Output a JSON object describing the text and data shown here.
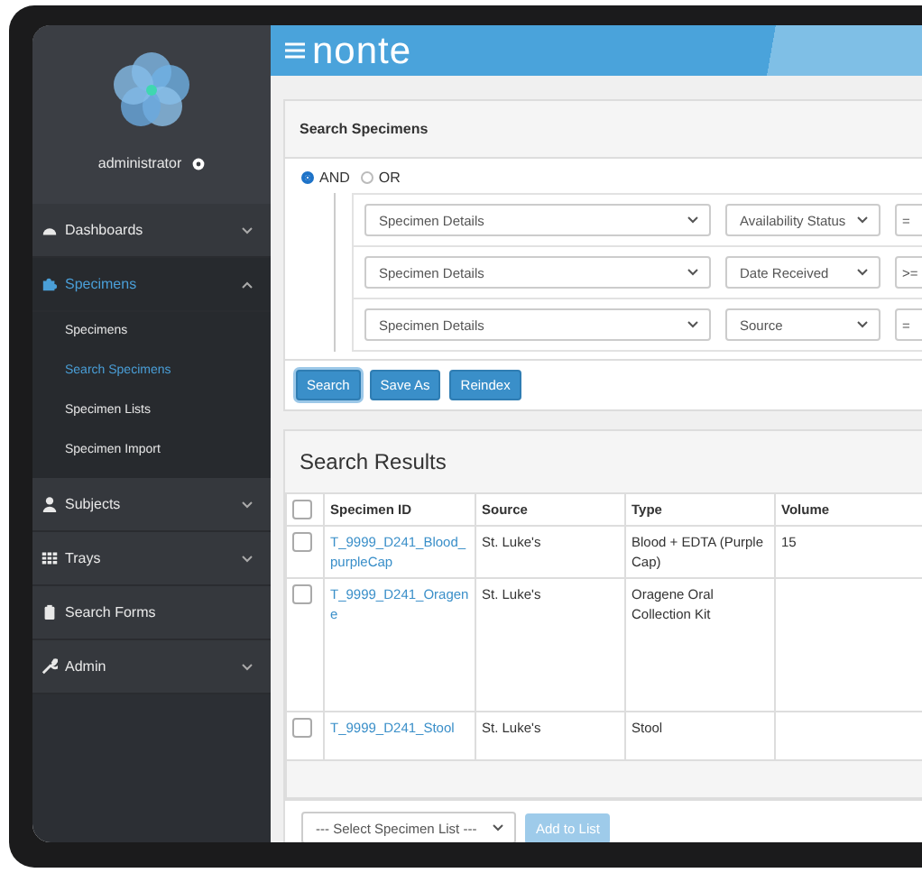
{
  "sidebar": {
    "user": "administrator",
    "items": [
      {
        "label": "Dashboards",
        "kind": "group",
        "expanded": false
      },
      {
        "label": "Specimens",
        "kind": "group",
        "expanded": true,
        "children": [
          {
            "label": "Specimens",
            "selected": false
          },
          {
            "label": "Search Specimens",
            "selected": true
          },
          {
            "label": "Specimen Lists",
            "selected": false
          },
          {
            "label": "Specimen Import",
            "selected": false
          }
        ]
      },
      {
        "label": "Subjects",
        "kind": "group",
        "expanded": false
      },
      {
        "label": "Trays",
        "kind": "group",
        "expanded": false
      },
      {
        "label": "Search Forms",
        "kind": "link",
        "expanded": false
      },
      {
        "label": "Admin",
        "kind": "group",
        "expanded": false
      }
    ]
  },
  "header": {
    "logo": "nonte"
  },
  "search_panel": {
    "title": "Search Specimens",
    "logic": [
      {
        "label": "AND",
        "selected": true
      },
      {
        "label": "OR",
        "selected": false
      }
    ],
    "criteria": [
      {
        "group": "Specimen Details",
        "field": "Availability Status",
        "operator": "="
      },
      {
        "group": "Specimen Details",
        "field": "Date Received",
        "operator": ">="
      },
      {
        "group": "Specimen Details",
        "field": "Source",
        "operator": "="
      }
    ],
    "buttons": [
      {
        "label": "Search",
        "focused": true
      },
      {
        "label": "Save As",
        "focused": false
      },
      {
        "label": "Reindex",
        "focused": false
      }
    ]
  },
  "results": {
    "title": "Search Results",
    "all_checked": false,
    "columns": [
      "Specimen ID",
      "Source",
      "Type",
      "Volume"
    ],
    "rows": [
      {
        "checked": false,
        "id": "T_9999_D241_Blood_purpleCap",
        "source": "St. Luke's",
        "type": "Blood + EDTA (Purple Cap)",
        "volume": "15"
      },
      {
        "checked": false,
        "id": "T_9999_D241_Oragene",
        "source": "St. Luke's",
        "type": "Oragene Oral Collection Kit",
        "volume": ""
      },
      {
        "checked": false,
        "id": "T_9999_D241_Stool",
        "source": "St. Luke's",
        "type": "Stool",
        "volume": ""
      }
    ],
    "list_select": {
      "placeholder": "--- Select Specimen List ---"
    },
    "add_button": {
      "label": "Add to List",
      "disabled": true
    }
  }
}
